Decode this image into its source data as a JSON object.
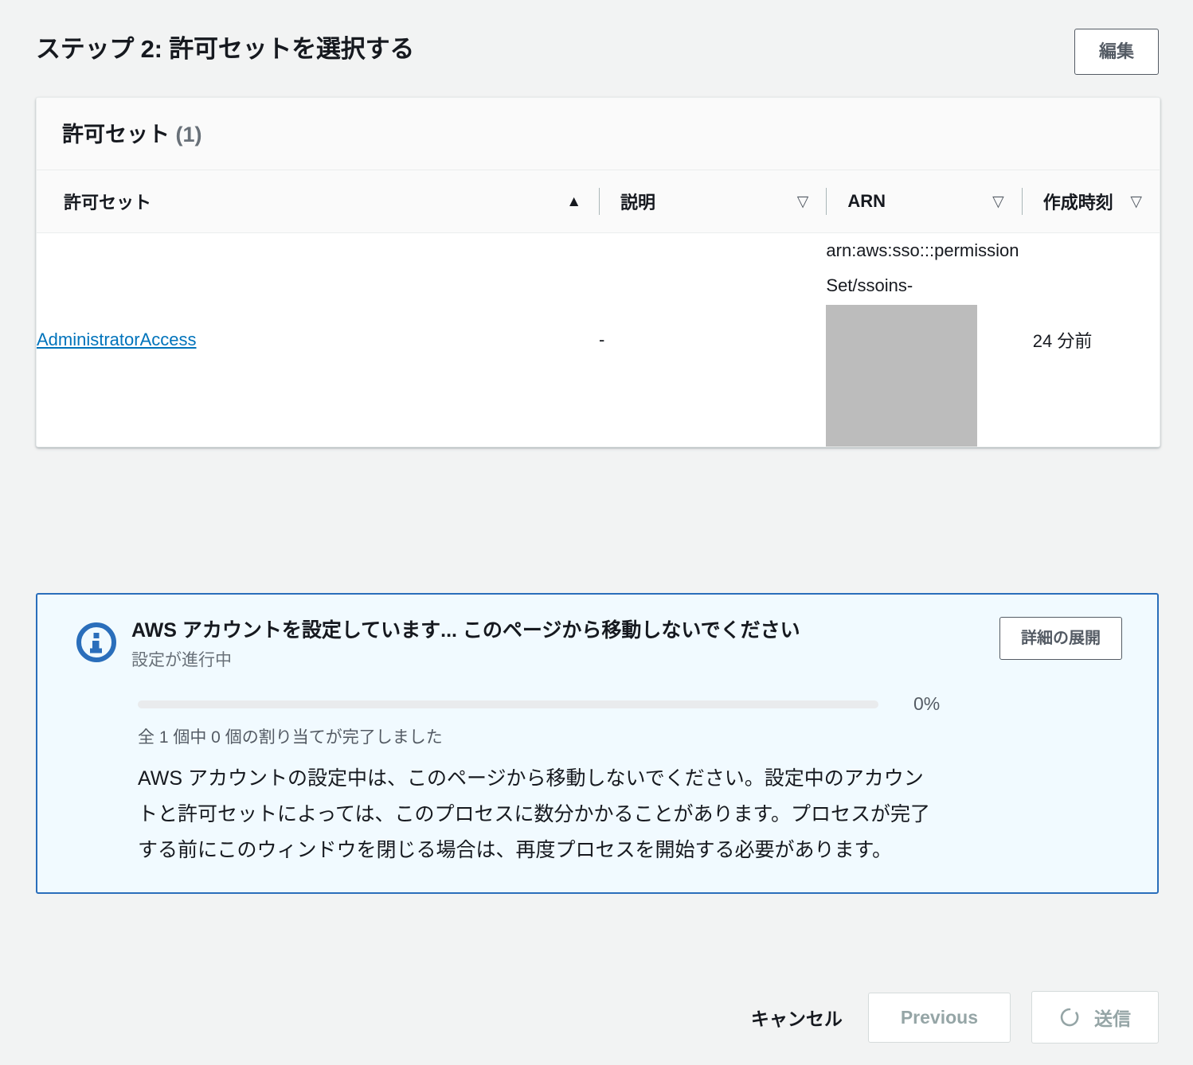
{
  "step": {
    "title": "ステップ 2: 許可セットを選択する",
    "edit_label": "編集"
  },
  "panel": {
    "title_text": "許可セット",
    "count_text": "(1)",
    "columns": [
      {
        "label": "許可セット",
        "sort_icon": "▲",
        "sorted": true
      },
      {
        "label": "説明",
        "sort_icon": "▽",
        "sorted": false
      },
      {
        "label": "ARN",
        "sort_icon": "▽",
        "sorted": false
      },
      {
        "label": "作成時刻",
        "sort_icon": "▽",
        "sorted": false
      }
    ],
    "rows": [
      {
        "name": "AdministratorAccess",
        "description": "-",
        "arn": "arn:aws:sso:::permissionSet/ssoins-",
        "created": "24 分前"
      }
    ]
  },
  "alert": {
    "icon": "info-icon",
    "heading": "AWS アカウントを設定しています... このページから移動しないでください",
    "subtitle": "設定が進行中",
    "expand_label": "詳細の展開",
    "progress_percent_label": "0%",
    "progress_value": 0,
    "progress_caption": "全 1 個中 0 個の割り当てが完了しました",
    "body": "AWS アカウントの設定中は、このページから移動しないでください。設定中のアカウントと許可セットによっては、このプロセスに数分かかることがあります。プロセスが完了する前にこのウィンドウを閉じる場合は、再度プロセスを開始する必要があります。"
  },
  "footer": {
    "cancel_label": "キャンセル",
    "previous_label": "Previous",
    "submit_label": "送信",
    "submit_icon": "loading-spinner-icon"
  },
  "colors": {
    "accent_blue": "#0073bb",
    "alert_border": "#2a6ebb",
    "alert_background": "#f1faff",
    "page_background": "#f2f3f3",
    "redaction": "#bcbcbc"
  }
}
